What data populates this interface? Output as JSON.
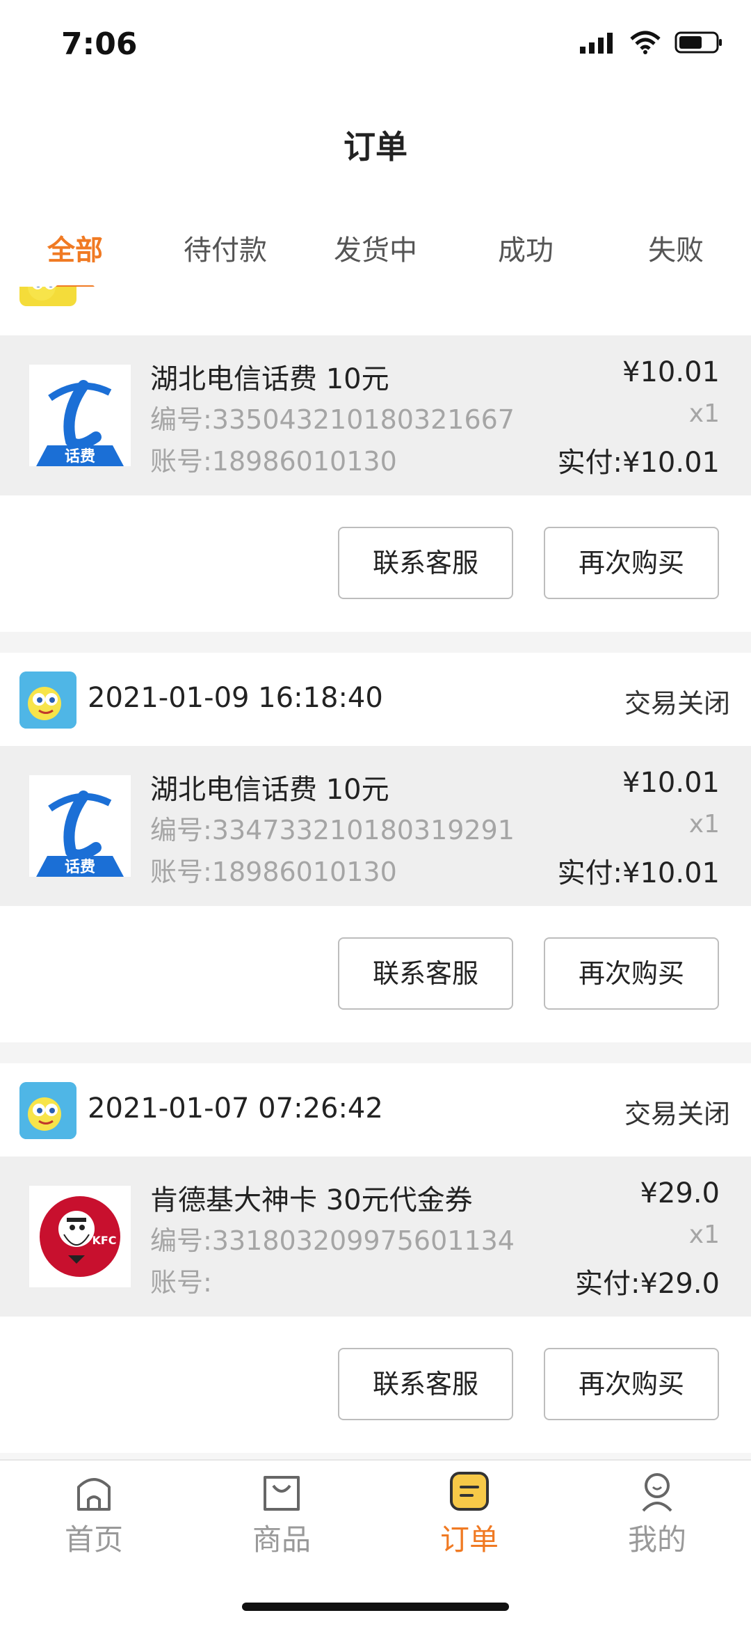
{
  "status_bar": {
    "time": "7:06"
  },
  "header": {
    "title": "订单"
  },
  "tabs": [
    {
      "label": "全部",
      "active": true
    },
    {
      "label": "待付款"
    },
    {
      "label": "发货中"
    },
    {
      "label": "成功"
    },
    {
      "label": "失败"
    }
  ],
  "orders": [
    {
      "item": {
        "name": "湖北电信话费 10元",
        "code": "编号:335043210180321667",
        "account": "账号:18986010130",
        "price": "¥10.01",
        "qty": "x1",
        "paid": "实付:¥10.01",
        "logo_label": "话费"
      }
    },
    {
      "date": "2021-01-09 16:18:40",
      "status": "交易关闭",
      "item": {
        "name": "湖北电信话费 10元",
        "code": "编号:334733210180319291",
        "account": "账号:18986010130",
        "price": "¥10.01",
        "qty": "x1",
        "paid": "实付:¥10.01",
        "logo_label": "话费"
      }
    },
    {
      "date": "2021-01-07 07:26:42",
      "status": "交易关闭",
      "item": {
        "name": "肯德基大神卡 30元代金券",
        "code": "编号:331803209975601134",
        "account": "账号:",
        "price": "¥29.0",
        "qty": "x1",
        "paid": "实付:¥29.0",
        "logo_label": "KFC"
      }
    }
  ],
  "actions": {
    "contact": "联系客服",
    "rebuy": "再次购买"
  },
  "tabbar": [
    {
      "label": "首页",
      "icon": "home-icon"
    },
    {
      "label": "商品",
      "icon": "bag-icon"
    },
    {
      "label": "订单",
      "icon": "order-icon",
      "active": true
    },
    {
      "label": "我的",
      "icon": "person-icon"
    }
  ],
  "colors": {
    "accent": "#f07a23",
    "brand_blue": "#1b6fd6",
    "item_bg": "#efefef"
  }
}
